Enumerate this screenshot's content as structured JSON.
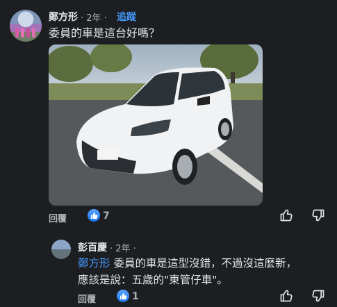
{
  "main_comment": {
    "author": "鄭方形",
    "time": "· 2年 ·",
    "follow_label": "追蹤",
    "text": "委員的車是這台好嗎？",
    "reply_label": "回覆",
    "like_count": "7"
  },
  "reply": {
    "author": "彭百慶",
    "time": "· 2年 ·",
    "mention": "鄭方形",
    "text_line1": " 委員的車是這型沒錯，不過沒這麼新，",
    "text_line2": "應該是說：五歲的\"東管仔車\"。",
    "reply_label": "回覆",
    "like_count": "1"
  },
  "colors": {
    "background": "#1d1e21",
    "link": "#4599ff",
    "like_blue": "#1877f2"
  },
  "icons": [
    "thumbs-up-icon",
    "thumbs-down-icon"
  ]
}
